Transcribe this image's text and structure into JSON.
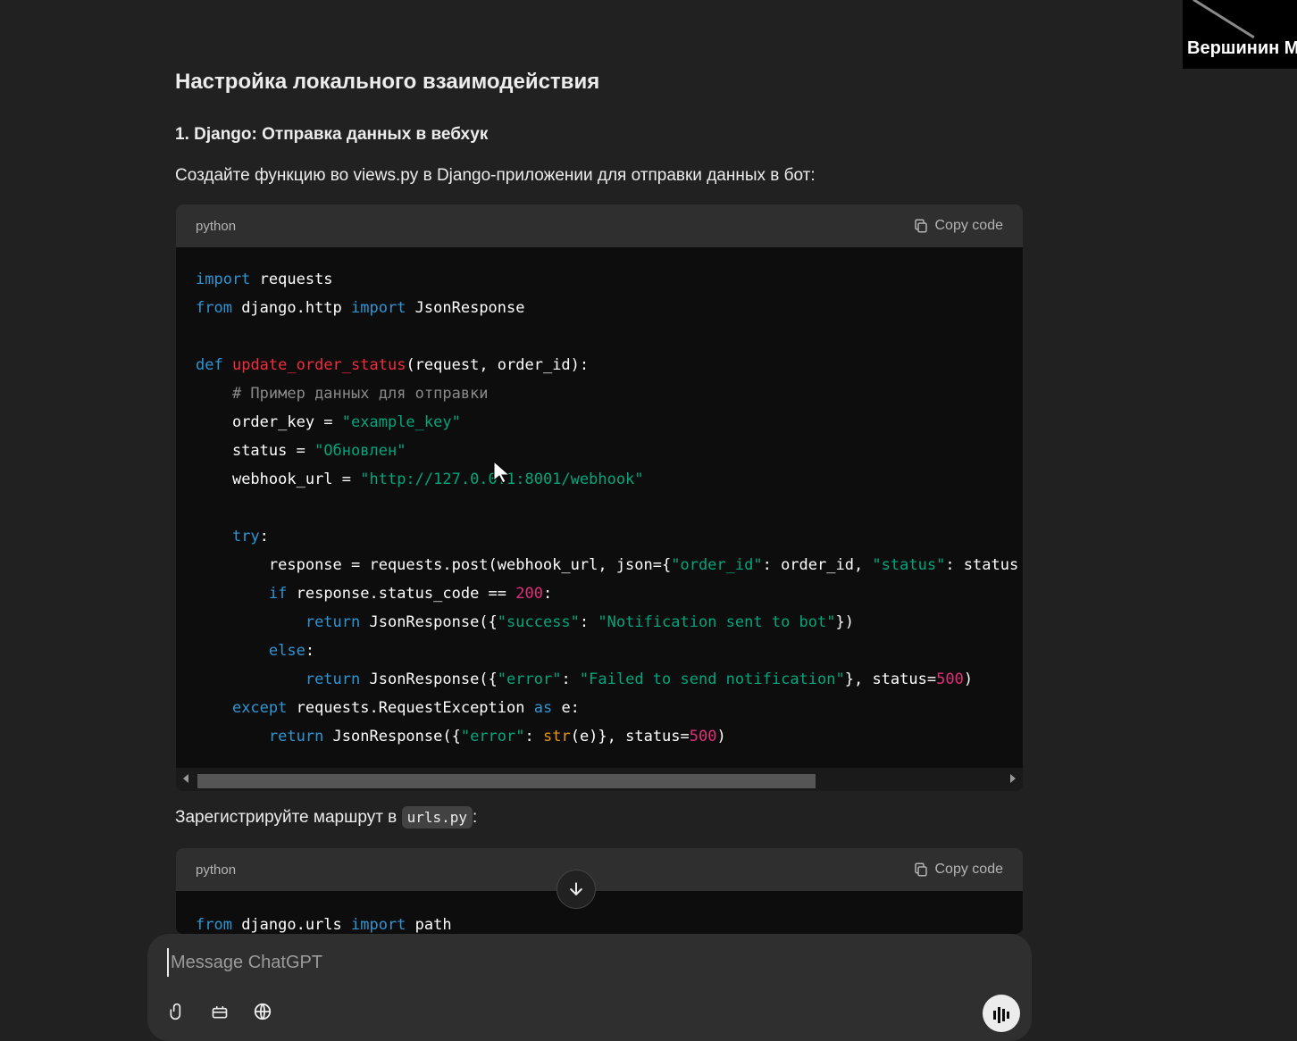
{
  "section_title": "Настройка локального взаимодействия",
  "subsection_title": "1. Django: Отправка данных в вебхук",
  "intro_text": "Создайте функцию во views.py в Django-приложении для отправки данных в бот:",
  "code_block_1": {
    "language": "python",
    "copy_label": "Copy code",
    "lines": {
      "l1": {
        "kw": "import",
        "rest": " requests"
      },
      "l2": {
        "kw1": "from",
        "mod": " django.http ",
        "kw2": "import",
        "rest": " JsonResponse"
      },
      "l4": {
        "kw": "def",
        "fn": "update_order_status",
        "rest": "(request, order_id):"
      },
      "l5": {
        "comment": "# Пример данных для отправки"
      },
      "l6": {
        "pre": "order_key = ",
        "str": "\"example_key\""
      },
      "l7": {
        "pre": "status = ",
        "str": "\"Обновлен\""
      },
      "l8": {
        "pre": "webhook_url = ",
        "str": "\"http://127.0.0.1:8001/webhook\""
      },
      "l10": {
        "kw": "try",
        "rest": ":"
      },
      "l11": {
        "pre": "response = requests.post(webhook_url, json={",
        "s1": "\"order_id\"",
        "mid": ": order_id, ",
        "s2": "\"status\"",
        "post": ": status"
      },
      "l12": {
        "kw": "if",
        "pre": " response.status_code == ",
        "num": "200",
        "post": ":"
      },
      "l13": {
        "kw": "return",
        "pre": " JsonResponse({",
        "s1": "\"success\"",
        "mid": ": ",
        "s2": "\"Notification sent to bot\"",
        "post": "})"
      },
      "l14": {
        "kw": "else",
        "post": ":"
      },
      "l15": {
        "kw": "return",
        "pre": " JsonResponse({",
        "s1": "\"error\"",
        "mid": ": ",
        "s2": "\"Failed to send notification\"",
        "post": "}, status=",
        "num": "500",
        "end": ")"
      },
      "l16": {
        "kw1": "except",
        "mid": " requests.RequestException ",
        "kw2": "as",
        "post": " e:"
      },
      "l17": {
        "kw": "return",
        "pre": " JsonResponse({",
        "s1": "\"error\"",
        "mid": ": ",
        "bi": "str",
        "post": "(e)}, status=",
        "num": "500",
        "end": ")"
      }
    }
  },
  "register_text_prefix": "Зарегистрируйте маршрут в ",
  "register_code": "urls.py",
  "register_text_suffix": ":",
  "code_block_2": {
    "language": "python",
    "copy_label": "Copy code",
    "lines": {
      "l1": {
        "kw1": "from",
        "mod": " django.urls ",
        "kw2": "import",
        "rest": " path"
      }
    }
  },
  "composer": {
    "placeholder": "Message ChatGPT"
  },
  "webcam": {
    "name": "Вершинин М"
  },
  "colors": {
    "background": "#212121",
    "code_bg": "#0d0d0d",
    "code_header": "#2f2f2f",
    "keyword": "#2e95d3",
    "function": "#f22c3d",
    "string": "#00a67d",
    "number": "#df3079",
    "builtin": "#e9950c"
  }
}
